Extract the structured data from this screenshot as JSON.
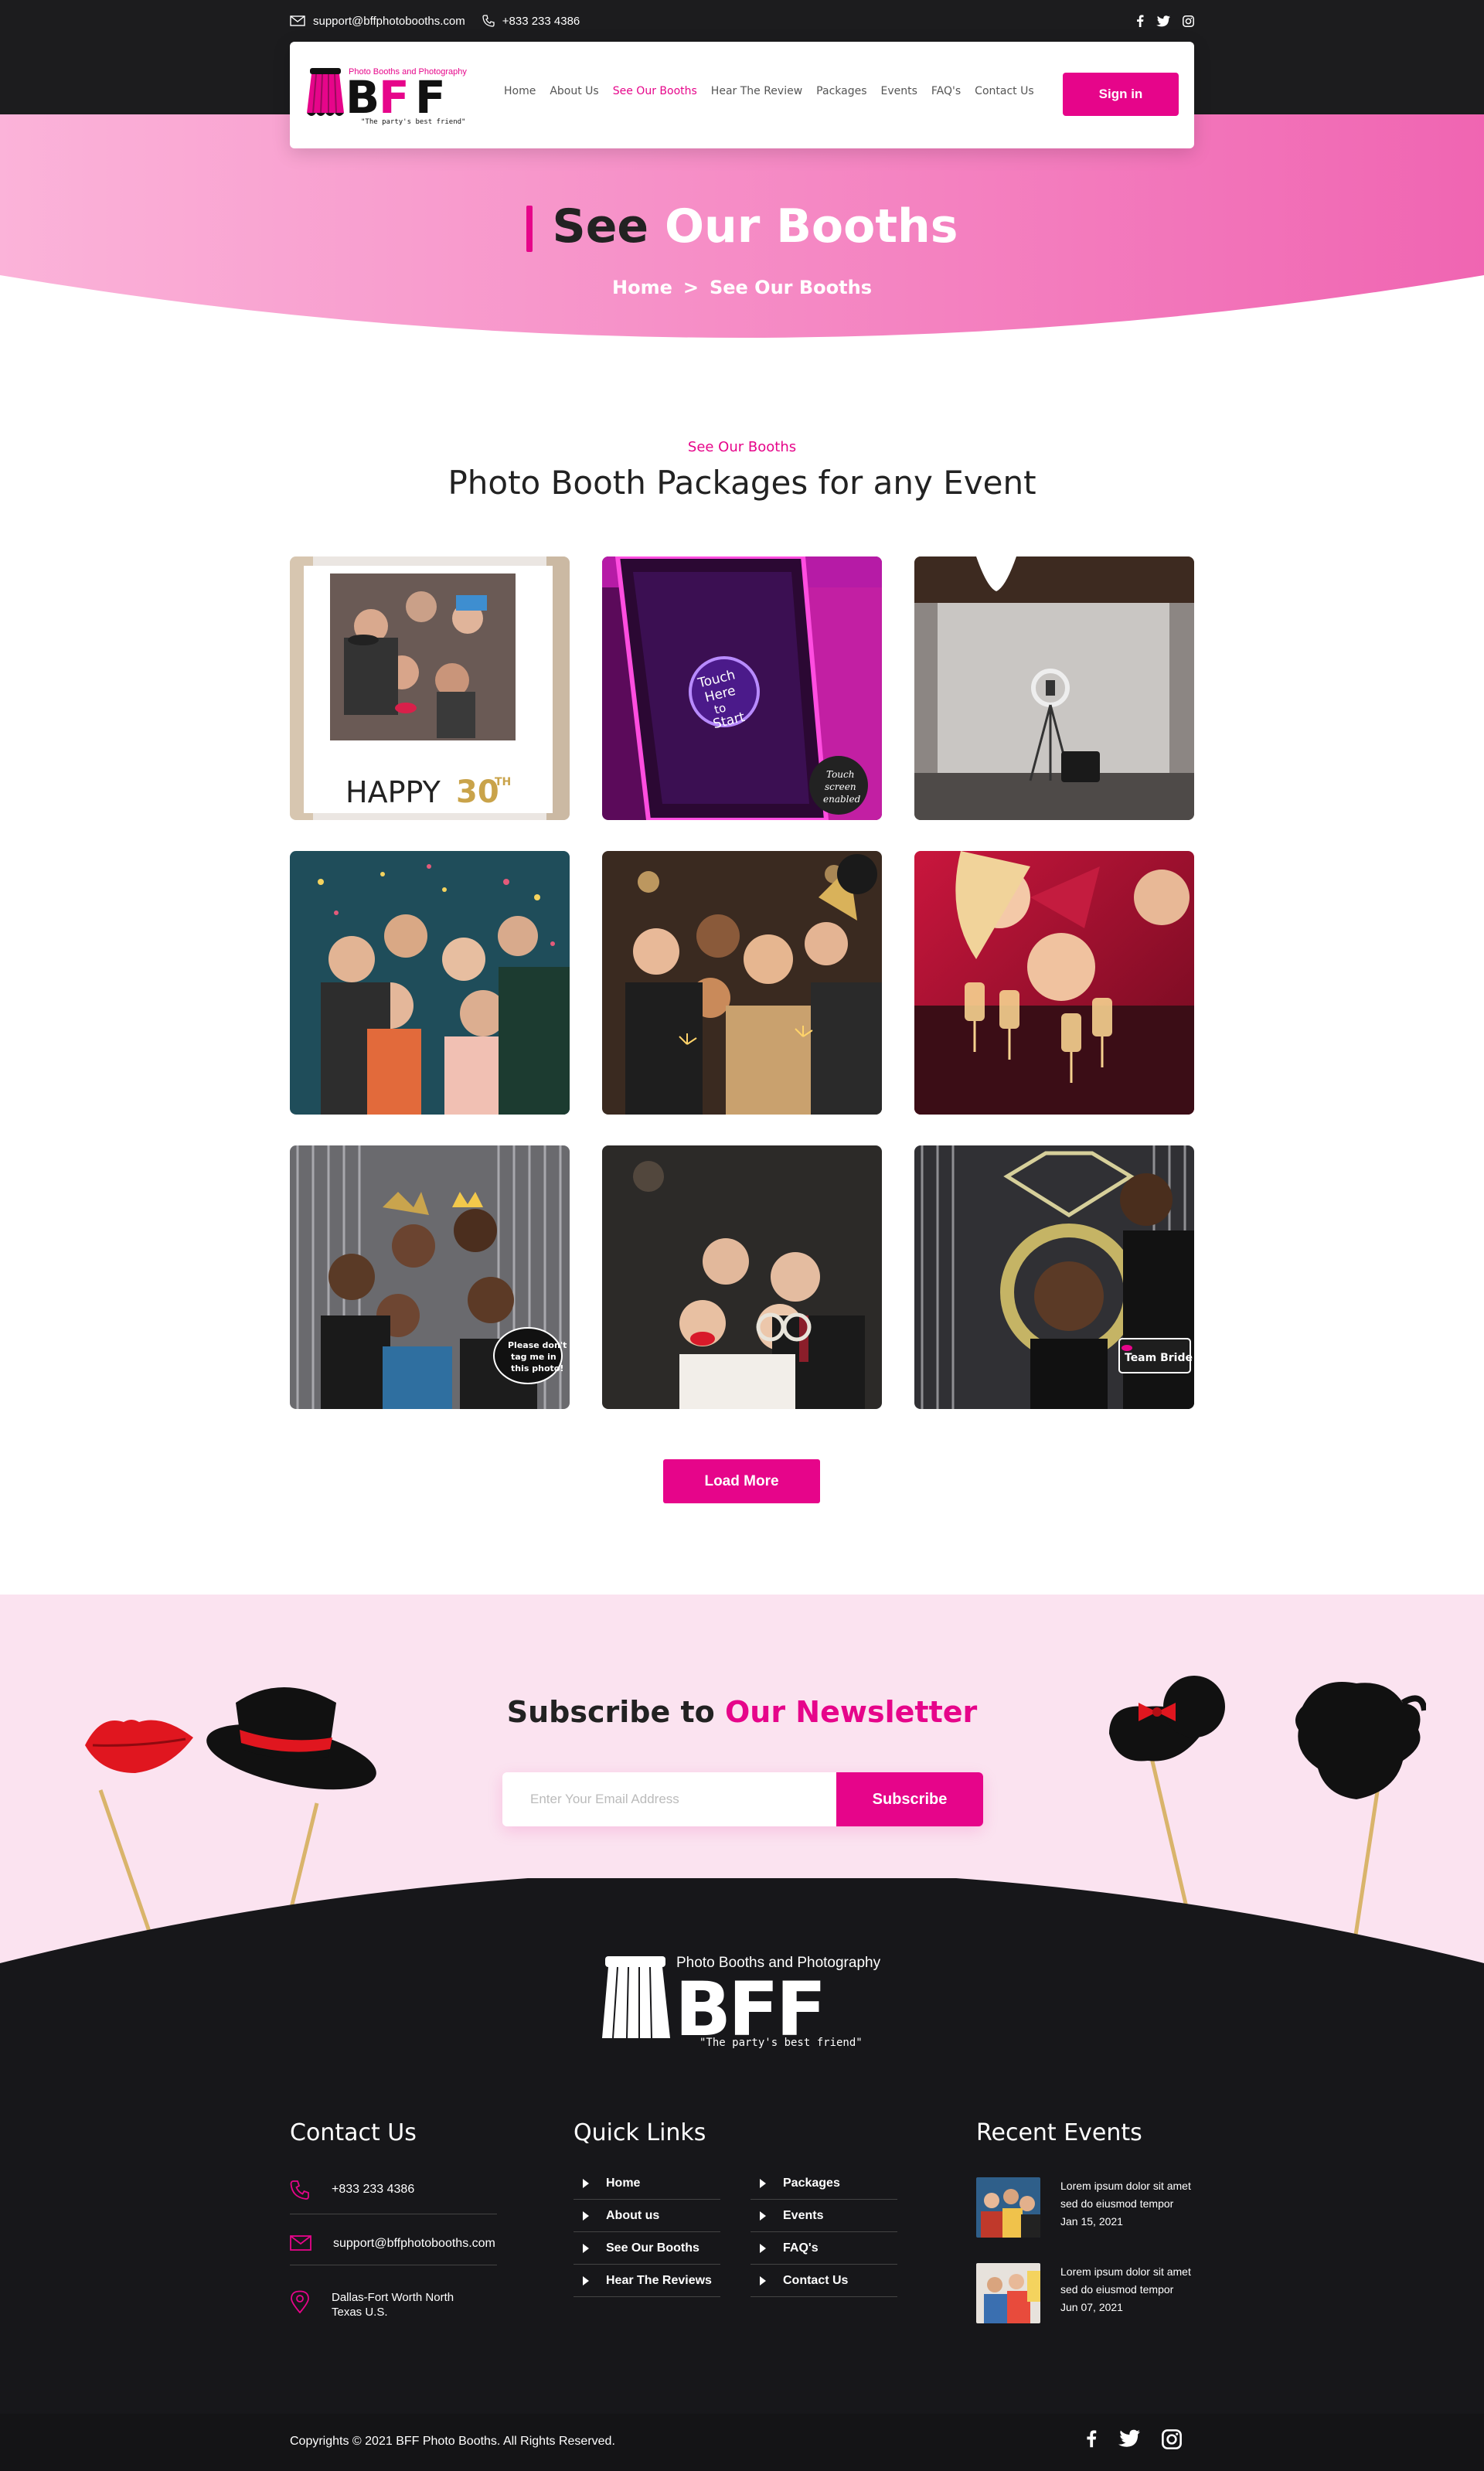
{
  "topbar": {
    "email": "support@bffphotobooths.com",
    "phone": "+833 233 4386"
  },
  "brand": {
    "tagline_top": "Photo Booths and Photography",
    "wordmark": "BFF",
    "slogan": "\"The party's best friend\""
  },
  "nav": {
    "items": [
      "Home",
      "About Us",
      "See Our Booths",
      "Hear The Review",
      "Packages",
      "Events",
      "FAQ's",
      "Contact Us"
    ],
    "active": "See Our Booths",
    "signin": "Sign in"
  },
  "hero": {
    "title_dark": "See",
    "title_light": "Our Booths",
    "breadcrumb_home": "Home",
    "breadcrumb_sep": ">",
    "breadcrumb_current": "See Our Booths"
  },
  "section": {
    "eyebrow": "See Our Booths",
    "title": "Photo Booth Packages for any Event",
    "load_more": "Load More"
  },
  "gallery": {
    "captions": {
      "frame_text": "HAPPY 30TH",
      "touch_text": "Touch Here to Start",
      "badge_text": "Touch screen enabled",
      "tag_sign": "Please don't tag me in this photo!",
      "team_bride": "Team Bride"
    }
  },
  "newsletter": {
    "title_dark": "Subscribe to",
    "title_pink": "Our Newsletter",
    "placeholder": "Enter Your Email Address",
    "button": "Subscribe"
  },
  "footer": {
    "contact_title": "Contact Us",
    "phone": "+833 233 4386",
    "email": "support@bffphotobooths.com",
    "address_line1": "Dallas-Fort Worth North",
    "address_line2": "Texas U.S.",
    "links_title": "Quick Links",
    "links_col1": [
      "Home",
      "About us",
      "See Our Booths",
      "Hear The Reviews"
    ],
    "links_col2": [
      "Packages",
      "Events",
      "FAQ's",
      "Contact Us"
    ],
    "events_title": "Recent Events",
    "events": [
      {
        "line1": "Lorem ipsum dolor sit amet",
        "line2": "sed do eiusmod tempor",
        "date": "Jan 15, 2021"
      },
      {
        "line1": "Lorem ipsum dolor sit amet",
        "line2": "sed do eiusmod tempor",
        "date": "Jun 07, 2021"
      }
    ],
    "copyright": "Copyrights © 2021 BFF Photo Booths. All Rights Reserved."
  },
  "colors": {
    "accent": "#e6058a",
    "dark": "#1c1c1e",
    "pink_light": "#fbe3f0"
  }
}
